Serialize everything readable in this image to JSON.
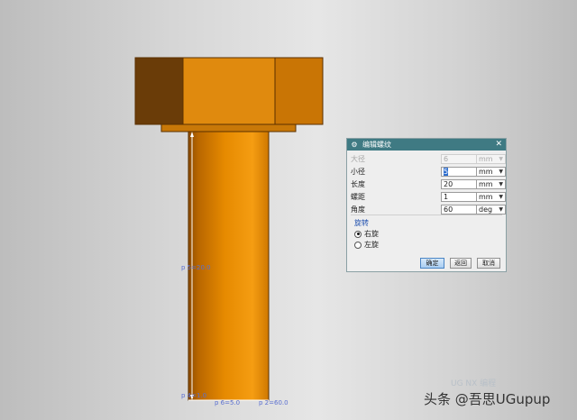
{
  "viewport": {
    "dim_length_label": "p 5=20.0",
    "dim_base_label": "p 4=1.0",
    "dim_diameter_label": "p 6=5.0",
    "dim_angle_label": "p 2=60.0"
  },
  "dialog": {
    "title": "编辑螺纹",
    "close_icon": "close-icon",
    "fields": [
      {
        "label": "大径",
        "value": "6",
        "unit": "mm",
        "disabled": true
      },
      {
        "label": "小径",
        "value": "5",
        "unit": "mm",
        "selected": true
      },
      {
        "label": "长度",
        "value": "20",
        "unit": "mm"
      },
      {
        "label": "螺距",
        "value": "1",
        "unit": "mm"
      },
      {
        "label": "角度",
        "value": "60",
        "unit": "deg"
      }
    ],
    "rotation_group": {
      "title": "旋转",
      "options": [
        {
          "label": "右旋",
          "checked": true
        },
        {
          "label": "左旋",
          "checked": false
        }
      ]
    },
    "buttons": {
      "ok": "确定",
      "back": "返回",
      "cancel": "取消"
    }
  },
  "watermark": {
    "text": "头条 @吾思UGupup",
    "faint_text": "UG NX 编程"
  }
}
